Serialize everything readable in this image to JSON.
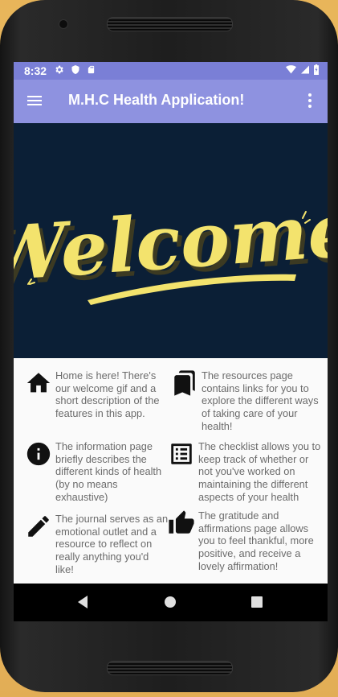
{
  "status_bar": {
    "time": "8:32",
    "icons_left": [
      "gear-icon",
      "shield-icon",
      "sd-card-icon"
    ],
    "icons_right": [
      "wifi-icon",
      "cell-signal-icon",
      "battery-icon"
    ]
  },
  "app_bar": {
    "title": "M.H.C Health Application!",
    "menu_icon": "hamburger-menu-icon",
    "overflow_icon": "more-vert-icon"
  },
  "hero": {
    "text": "Welcome"
  },
  "features": [
    {
      "icon": "home-icon",
      "text": "Home is here! There's our welcome gif and a short description of the features in this app."
    },
    {
      "icon": "bookmarks-icon",
      "text": "The resources page contains links for you to explore the different ways of taking care of your health!"
    },
    {
      "icon": "info-icon",
      "text": "The information page briefly describes the different kinds of health (by no means exhaustive)"
    },
    {
      "icon": "checklist-icon",
      "text": "The checklist allows you to keep track of whether or not you've worked on maintaining the different aspects of your health"
    },
    {
      "icon": "pencil-icon",
      "text": "The journal serves as an emotional outlet and a resource to reflect on really anything you'd like!"
    },
    {
      "icon": "thumbs-up-icon",
      "text": "The gratitude and affirmations page allows you to feel thankful, more positive, and receive a lovely affirmation!"
    }
  ],
  "nav_bar": {
    "buttons": [
      "back-icon",
      "home-circle-icon",
      "recents-icon"
    ]
  },
  "colors": {
    "status_bar": "#7a7fd6",
    "app_bar": "#8e92e0",
    "hero_background": "#0b1f36",
    "hero_text": "#f3e36d",
    "hero_text_shadow": "#3c3a22",
    "feature_text": "#6b6b6b"
  }
}
